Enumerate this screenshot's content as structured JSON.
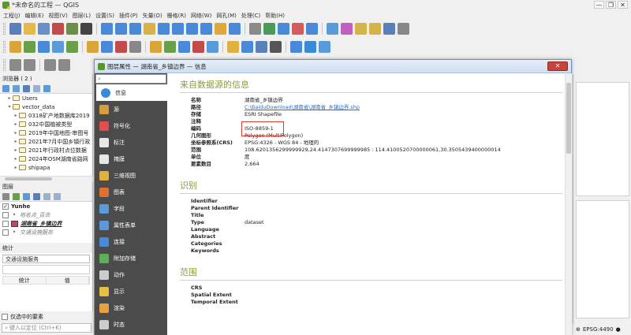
{
  "window": {
    "title": "*未命名的工程 — QGIS",
    "controls": [
      "—",
      "❐",
      "✕"
    ]
  },
  "menu": [
    "工程(J)",
    "编辑(E)",
    "视图(V)",
    "图层(L)",
    "设置(S)",
    "插件(P)",
    "矢量(O)",
    "栅格(R)",
    "网络(W)",
    "网孔(M)",
    "处理(C)",
    "帮助(H)"
  ],
  "toolbar_colors": {
    "row1": [
      "#5b7fb7",
      "#e6b84c",
      "#6a8fc7",
      "#c14b4b",
      "#6a8f4a",
      "#444444",
      "#4a89d8",
      "#4a89d8",
      "#4a89d8",
      "#d7b24a",
      "#4a89d8",
      "#4a89d8",
      "#4a89d8",
      "#4a89d8",
      "#e0a83a",
      "#4a89d8",
      "#8a8a8a",
      "#4a9a5a",
      "#4a89d8",
      "#d35b5b",
      "#4a89d8",
      "#5a9ad8",
      "#c060c0",
      "#d4b44a",
      "#d4b44a",
      "#5b7fb7",
      "#888888"
    ],
    "row2": [
      "#d9a43a",
      "#6a9f4a",
      "#4a89d8",
      "#5a9ad8",
      "#6a9f4a",
      "#d9a43a",
      "#4a89d8",
      "#c14b4b",
      "#888888",
      "#d9a43a",
      "#6a9f4a",
      "#4a89d8",
      "#c14b4b",
      "#5a9ad8",
      "#e0b040",
      "#4a89d8",
      "#5b7fb7",
      "#555555",
      "#4a89d8",
      "#3a8ad8",
      "#5a9ad8"
    ],
    "row3": [
      "#8a8a8a",
      "#8a8a8a",
      "#8a8a8a",
      "#8a8a8a"
    ]
  },
  "browser": {
    "header": "浏览器 ( 2 )",
    "items": [
      {
        "label": "Users",
        "indent": 1,
        "arrow": "▸"
      },
      {
        "label": "vector_data",
        "indent": 1,
        "arrow": "▾"
      },
      {
        "label": "0318矿产地数据库2019",
        "indent": 2,
        "arrow": "▸"
      },
      {
        "label": "032中国植被类型",
        "indent": 2,
        "arrow": "▸"
      },
      {
        "label": "2019年中国地图-审图号",
        "indent": 2,
        "arrow": "▸"
      },
      {
        "label": "2021年7月中国乡镇行政",
        "indent": 2,
        "arrow": "▸"
      },
      {
        "label": "2021年行政村点位数据",
        "indent": 2,
        "arrow": "▸"
      },
      {
        "label": "2024年OSM湖南省路网",
        "indent": 2,
        "arrow": "▸"
      },
      {
        "label": "shipapa",
        "indent": 2,
        "arrow": "▸"
      }
    ]
  },
  "layers": {
    "header": "图层",
    "items": [
      {
        "label": "Yunhe",
        "checked": true,
        "style": "bold",
        "symbol": "none"
      },
      {
        "label": "地名点_百合",
        "checked": false,
        "style": "italic",
        "symbol": "dot"
      },
      {
        "label": "湖南省_乡镇边界",
        "checked": false,
        "style": "bold-italic",
        "symbol": "poly"
      },
      {
        "label": "交通设施服务",
        "checked": false,
        "style": "italic",
        "symbol": "dot"
      }
    ]
  },
  "stats": {
    "header": "统计",
    "layer_combo": "交通设施服务",
    "col_stat": "统计",
    "col_value": "值",
    "selected_only": "仅选中的要素"
  },
  "locator": {
    "placeholder": "键入以定位 (Ctrl+K)"
  },
  "status": {
    "crs": "EPSG:4490"
  },
  "dialog": {
    "title": "图层属性 — 湖南省_乡镇边界 — 信息",
    "close": "✕",
    "search_placeholder": "",
    "nav": [
      {
        "label": "信息",
        "icon_color": "#3a8ad8"
      },
      {
        "label": "源",
        "icon_color": "#d4a03a"
      },
      {
        "label": "符号化",
        "icon_color": "#e05050"
      },
      {
        "label": "标注",
        "icon_color": "#e8e8e8"
      },
      {
        "label": "掩膜",
        "icon_color": "#e8e8e8"
      },
      {
        "label": "三维视图",
        "icon_color": "#e0b040"
      },
      {
        "label": "图表",
        "icon_color": "#e07030"
      },
      {
        "label": "字段",
        "icon_color": "#5a9ad8"
      },
      {
        "label": "属性表单",
        "icon_color": "#5a9ad8"
      },
      {
        "label": "连接",
        "icon_color": "#4a89d8"
      },
      {
        "label": "附加存储",
        "icon_color": "#5ab05a"
      },
      {
        "label": "动作",
        "icon_color": "#cccccc"
      },
      {
        "label": "显示",
        "icon_color": "#e8c040"
      },
      {
        "label": "渲染",
        "icon_color": "#e8a040"
      },
      {
        "label": "时态",
        "icon_color": "#cccccc"
      }
    ],
    "source_section": {
      "title": "来自数据源的信息",
      "rows": [
        {
          "key": "名称",
          "value": "湖南省_乡镇边界"
        },
        {
          "key": "路径",
          "value": "C:\\BaiduDownload\\湖南省\\湖南省_乡镇边界.shp",
          "link": true
        },
        {
          "key": "存储",
          "value": "ESRI Shapefile"
        },
        {
          "key": "注释",
          "value": ""
        },
        {
          "key": "编码",
          "value": "ISO-8859-1"
        },
        {
          "key": "几何图形",
          "value": "Polygon (MultiPolygon)"
        },
        {
          "key": "坐标参照系(CRS)",
          "value": "EPSG:4326 - WGS 84 - 地理的"
        },
        {
          "key": "范围",
          "value": "108.6201356299999929,24.4147307699999985 : 114.4100520700000061,30.3505439400000014"
        },
        {
          "key": "单位",
          "value": "度"
        },
        {
          "key": "要素数目",
          "value": "2,664"
        }
      ],
      "highlight_color": "#d83a2e"
    },
    "identification_section": {
      "title": "识别",
      "rows": [
        {
          "key": "Identifier",
          "value": ""
        },
        {
          "key": "Parent Identifier",
          "value": ""
        },
        {
          "key": "Title",
          "value": ""
        },
        {
          "key": "Type",
          "value": "dataset"
        },
        {
          "key": "Language",
          "value": ""
        },
        {
          "key": "Abstract",
          "value": ""
        },
        {
          "key": "Categories",
          "value": ""
        },
        {
          "key": "Keywords",
          "value": ""
        }
      ]
    },
    "extent_section": {
      "title": "范围",
      "rows": [
        {
          "key": "CRS",
          "value": ""
        },
        {
          "key": "Spatial Extent",
          "value": ""
        },
        {
          "key": "Temporal Extent",
          "value": ""
        }
      ]
    }
  }
}
